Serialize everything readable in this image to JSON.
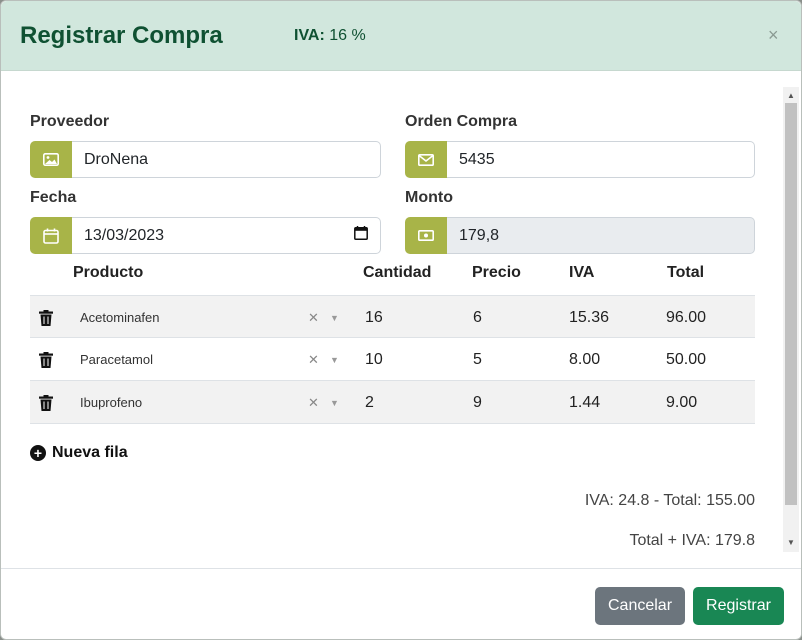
{
  "header": {
    "title": "Registrar Compra",
    "iva_label": "IVA:",
    "iva_value": "16 %",
    "close": "×"
  },
  "form": {
    "proveedor": {
      "label": "Proveedor",
      "value": "DroNena",
      "icon": "image-icon"
    },
    "orden": {
      "label": "Orden Compra",
      "value": "5435",
      "icon": "envelope-icon"
    },
    "fecha": {
      "label": "Fecha",
      "value": "13/03/2023",
      "icon": "calendar-icon"
    },
    "monto": {
      "label": "Monto",
      "value": "179,8",
      "icon": "cash-icon"
    }
  },
  "table": {
    "headers": {
      "producto": "Producto",
      "cantidad": "Cantidad",
      "precio": "Precio",
      "iva": "IVA",
      "total": "Total"
    },
    "rows": [
      {
        "producto": "Acetominafen",
        "cantidad": "16",
        "precio": "6",
        "iva": "15.36",
        "total": "96.00"
      },
      {
        "producto": "Paracetamol",
        "cantidad": "10",
        "precio": "5",
        "iva": "8.00",
        "total": "50.00"
      },
      {
        "producto": "Ibuprofeno",
        "cantidad": "2",
        "precio": "9",
        "iva": "1.44",
        "total": "9.00"
      }
    ],
    "clear_glyph": "✕",
    "caret_glyph": "▼"
  },
  "add_row": {
    "label": "Nueva fila",
    "plus": "+"
  },
  "summary": {
    "line1": "IVA: 24.8 - Total: 155.00",
    "line2": "Total + IVA: 179.8"
  },
  "footer": {
    "cancel": "Cancelar",
    "submit": "Registrar"
  },
  "colors": {
    "header_bg": "#d1e7dd",
    "title": "#0f5132",
    "addon": "#a8b448",
    "cancel": "#6c757d",
    "submit": "#198754"
  }
}
